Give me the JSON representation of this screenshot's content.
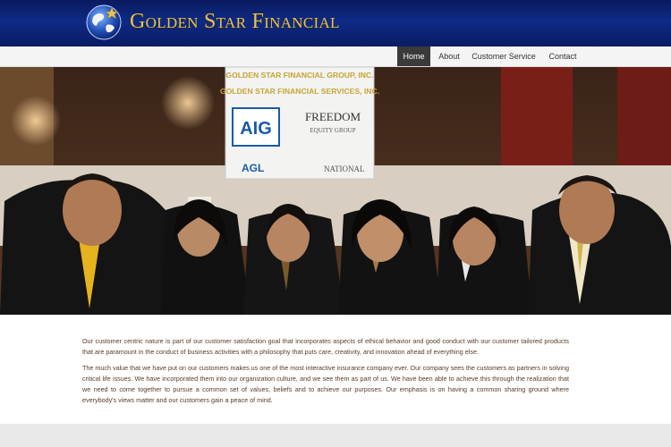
{
  "header": {
    "brand_name": "Golden Star Financial",
    "logo_icon": "globe-star-icon"
  },
  "nav": {
    "items": [
      {
        "label": "Home",
        "active": true
      },
      {
        "label": "About",
        "active": false
      },
      {
        "label": "Customer Service",
        "active": false
      },
      {
        "label": "Contact",
        "active": false
      }
    ]
  },
  "hero": {
    "banner_lines": [
      "GOLDEN STAR FINANCIAL GROUP, INC.",
      "GOLDEN STAR FINANCIAL SERVICES, INC."
    ],
    "logo_aig": "AIG",
    "logo_freedom": "FREEDOM",
    "logo_freedom_sub": "EQUITY GROUP",
    "logo_agl": "AGL",
    "logo_national": "NATIONAL"
  },
  "content": {
    "paragraph1": "Our customer centric nature is part of our customer satisfaction goal that incorporates aspects of ethical behavior and good conduct with our customer tailored products that are paramount in the conduct of business activities with a philosophy that puts care, creativity, and innovation ahead of everything else.",
    "paragraph2": "The much value that we have put on our customers makes us one of the most interactive insurance company ever. Our company sees the customers as partners in solving critical life issues. We have incorporated them into our organization culture, and we see them as part of us. We have been able to achieve this through the realization that we need to come together to pursue a common set of values, beliefs and to achieve our purposes. Our emphasis is on having a common sharing ground where everybody's views matter and our customers gain a peace of mind."
  },
  "colors": {
    "header_blue": "#0e2a86",
    "brand_gold": "#e7c256",
    "text_brown": "#5a3a2a"
  }
}
